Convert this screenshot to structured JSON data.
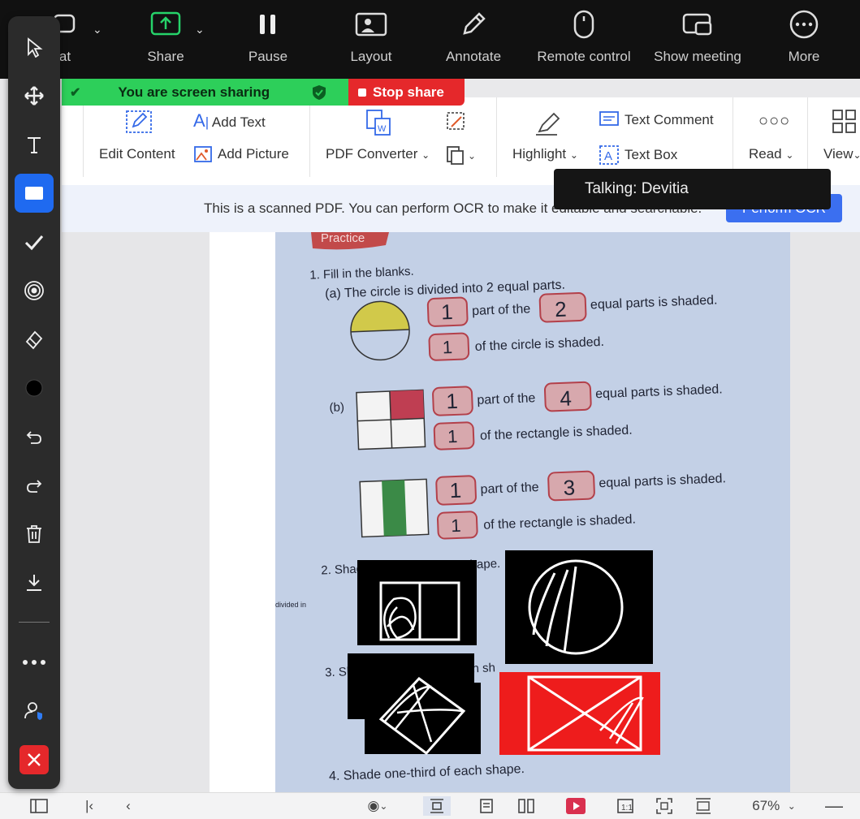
{
  "zoom_bar": {
    "items": [
      {
        "label": "at",
        "icon": "chat-icon"
      },
      {
        "label": "Share",
        "icon": "share-screen-icon"
      },
      {
        "label": "Pause",
        "icon": "pause-icon"
      },
      {
        "label": "Layout",
        "icon": "layout-icon"
      },
      {
        "label": "Annotate",
        "icon": "pencil-icon"
      },
      {
        "label": "Remote control",
        "icon": "mouse-icon"
      },
      {
        "label": "Show meeting",
        "icon": "show-meeting-icon"
      },
      {
        "label": "More",
        "icon": "more-icon"
      }
    ]
  },
  "sharing": {
    "banner_text": "You are screen sharing",
    "stop_label": "Stop share",
    "banner_color": "#2dcf5a",
    "stop_color": "#e5282b"
  },
  "ribbon": {
    "edit_content": "Edit Content",
    "add_text": "Add Text",
    "add_picture": "Add Picture",
    "pdf_converter": "PDF Converter",
    "highlight": "Highlight",
    "text_comment": "Text Comment",
    "text_box": "Text Box",
    "read": "Read",
    "view": "View"
  },
  "ocr": {
    "message": "This is a scanned PDF. You can perform OCR to make it editable and searchable.",
    "button": "Perform OCR"
  },
  "talking": "Talking: Devitia",
  "worksheet": {
    "practice": "Practice",
    "q1": "1.  Fill in the blanks.",
    "q1a": "(a)  The circle is divided into 2 equal parts.",
    "part_of_the": "part of the",
    "equal_parts_shaded": "equal parts is shaded.",
    "of_circle": "of the circle is shaded.",
    "of_rect": "of the rectangle is shaded.",
    "b": "(b)",
    "a1": "1",
    "a2": "2",
    "b1": "1",
    "b2": "4",
    "c1": "1",
    "c2": "3",
    "q2": "2.  Shade one-half of each shape.",
    "q3": "3.  Sh",
    "q3b": "ch sh",
    "q4": "4.  Shade one-third of each shape.",
    "divided": "divided in"
  },
  "status_bar": {
    "zoom": "67%"
  },
  "annotation_tools": [
    "pointer-icon",
    "move-icon",
    "text-tool-icon",
    "rectangle-icon",
    "stamp-check-icon",
    "spotlight-icon",
    "eraser-icon",
    "color-dot-icon",
    "undo-icon",
    "redo-icon",
    "trash-icon",
    "save-icon",
    "more-dots-icon",
    "annotator-name-icon",
    "close-icon"
  ]
}
